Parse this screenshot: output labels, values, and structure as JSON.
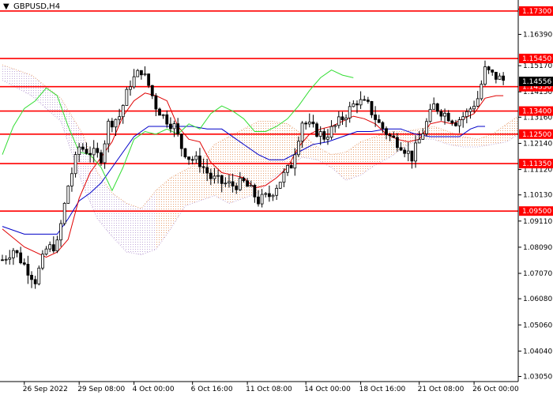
{
  "colors": {
    "background": "#ffffff",
    "level_line": "#ff0000",
    "candle": "#000000",
    "tenkan": "#e00000",
    "kijun": "#0000c8",
    "chikou": "#33dd33",
    "cloud_bull": "#e7a070",
    "cloud_bear": "#c0a8d8",
    "axis": "#000000",
    "price_tag": "#000000"
  },
  "chart_data": {
    "type": "line",
    "title": "GBPUSD,H4",
    "title_marker": "▼",
    "xlabel": "",
    "ylabel": "",
    "y_axis_position": "right",
    "ylim": [
      1.0285,
      1.177
    ],
    "xlim": [
      0,
      140
    ],
    "grid": false,
    "y_ticks": [
      "1.17370",
      "1.16390",
      "1.15170",
      "1.14150",
      "1.13160",
      "1.12140",
      "1.11120",
      "1.10130",
      "1.09110",
      "1.08090",
      "1.07070",
      "1.06080",
      "1.05060",
      "1.04040",
      "1.03050"
    ],
    "x_ticks": [
      {
        "label": "26 Sep 2022",
        "x": 6
      },
      {
        "label": "29 Sep 08:00",
        "x": 21
      },
      {
        "label": "4 Oct 00:00",
        "x": 36
      },
      {
        "label": "6 Oct 16:00",
        "x": 52
      },
      {
        "label": "11 Oct 08:00",
        "x": 67
      },
      {
        "label": "14 Oct 00:00",
        "x": 83
      },
      {
        "label": "18 Oct 16:00",
        "x": 98
      },
      {
        "label": "21 Oct 08:00",
        "x": 114
      },
      {
        "label": "26 Oct 00:00",
        "x": 129
      }
    ],
    "levels": [
      {
        "label": "1.17300",
        "value": 1.173
      },
      {
        "label": "1.15450",
        "value": 1.1545
      },
      {
        "label": "1.14350",
        "value": 1.1435
      },
      {
        "label": "1.13400",
        "value": 1.134
      },
      {
        "label": "1.12500",
        "value": 1.125
      },
      {
        "label": "1.11350",
        "value": 1.1135
      },
      {
        "label": "1.09500",
        "value": 1.095
      }
    ],
    "last_price": {
      "label": "1.14556",
      "value": 1.14556
    },
    "candles_anchors": [
      [
        0,
        1.076
      ],
      [
        3,
        1.08
      ],
      [
        6,
        1.074
      ],
      [
        9,
        1.068
      ],
      [
        12,
        1.08
      ],
      [
        15,
        1.082
      ],
      [
        18,
        1.105
      ],
      [
        21,
        1.12
      ],
      [
        24,
        1.118
      ],
      [
        27,
        1.116
      ],
      [
        29,
        1.129
      ],
      [
        32,
        1.132
      ],
      [
        35,
        1.145
      ],
      [
        38,
        1.15
      ],
      [
        40,
        1.144
      ],
      [
        42,
        1.136
      ],
      [
        44,
        1.132
      ],
      [
        47,
        1.128
      ],
      [
        49,
        1.12
      ],
      [
        51,
        1.116
      ],
      [
        54,
        1.114
      ],
      [
        57,
        1.108
      ],
      [
        60,
        1.106
      ],
      [
        63,
        1.105
      ],
      [
        66,
        1.106
      ],
      [
        68,
        1.103
      ],
      [
        70,
        1.099
      ],
      [
        73,
        1.101
      ],
      [
        76,
        1.107
      ],
      [
        79,
        1.113
      ],
      [
        82,
        1.13
      ],
      [
        85,
        1.127
      ],
      [
        88,
        1.124
      ],
      [
        91,
        1.128
      ],
      [
        94,
        1.133
      ],
      [
        97,
        1.138
      ],
      [
        100,
        1.136
      ],
      [
        103,
        1.129
      ],
      [
        106,
        1.124
      ],
      [
        109,
        1.121
      ],
      [
        112,
        1.116
      ],
      [
        115,
        1.126
      ],
      [
        118,
        1.136
      ],
      [
        121,
        1.133
      ],
      [
        124,
        1.13
      ],
      [
        127,
        1.133
      ],
      [
        130,
        1.139
      ],
      [
        132,
        1.15
      ],
      [
        134,
        1.148
      ],
      [
        137,
        1.146
      ]
    ],
    "tenkan": [
      [
        0,
        1.088
      ],
      [
        6,
        1.081
      ],
      [
        12,
        1.077
      ],
      [
        15,
        1.079
      ],
      [
        18,
        1.084
      ],
      [
        21,
        1.1
      ],
      [
        24,
        1.11
      ],
      [
        27,
        1.116
      ],
      [
        30,
        1.122
      ],
      [
        33,
        1.132
      ],
      [
        36,
        1.138
      ],
      [
        39,
        1.141
      ],
      [
        42,
        1.14
      ],
      [
        45,
        1.138
      ],
      [
        48,
        1.128
      ],
      [
        51,
        1.123
      ],
      [
        54,
        1.122
      ],
      [
        57,
        1.114
      ],
      [
        60,
        1.11
      ],
      [
        63,
        1.109
      ],
      [
        66,
        1.108
      ],
      [
        69,
        1.104
      ],
      [
        72,
        1.105
      ],
      [
        75,
        1.108
      ],
      [
        78,
        1.112
      ],
      [
        81,
        1.12
      ],
      [
        84,
        1.125
      ],
      [
        87,
        1.127
      ],
      [
        90,
        1.128
      ],
      [
        93,
        1.13
      ],
      [
        96,
        1.132
      ],
      [
        99,
        1.131
      ],
      [
        102,
        1.129
      ],
      [
        105,
        1.125
      ],
      [
        108,
        1.123
      ],
      [
        111,
        1.122
      ],
      [
        114,
        1.123
      ],
      [
        117,
        1.129
      ],
      [
        120,
        1.13
      ],
      [
        123,
        1.129
      ],
      [
        126,
        1.131
      ],
      [
        129,
        1.133
      ],
      [
        132,
        1.139
      ],
      [
        135,
        1.14
      ],
      [
        137,
        1.14
      ]
    ],
    "kijun": [
      [
        0,
        1.089
      ],
      [
        6,
        1.086
      ],
      [
        12,
        1.086
      ],
      [
        15,
        1.086
      ],
      [
        18,
        1.092
      ],
      [
        21,
        1.099
      ],
      [
        24,
        1.102
      ],
      [
        27,
        1.106
      ],
      [
        30,
        1.112
      ],
      [
        33,
        1.118
      ],
      [
        36,
        1.124
      ],
      [
        40,
        1.128
      ],
      [
        44,
        1.128
      ],
      [
        48,
        1.128
      ],
      [
        52,
        1.128
      ],
      [
        56,
        1.127
      ],
      [
        60,
        1.127
      ],
      [
        64,
        1.123
      ],
      [
        67,
        1.12
      ],
      [
        70,
        1.117
      ],
      [
        73,
        1.115
      ],
      [
        77,
        1.115
      ],
      [
        81,
        1.118
      ],
      [
        85,
        1.121
      ],
      [
        89,
        1.122
      ],
      [
        93,
        1.124
      ],
      [
        97,
        1.126
      ],
      [
        101,
        1.126
      ],
      [
        105,
        1.127
      ],
      [
        109,
        1.127
      ],
      [
        113,
        1.125
      ],
      [
        117,
        1.124
      ],
      [
        121,
        1.124
      ],
      [
        125,
        1.124
      ],
      [
        128,
        1.127
      ],
      [
        130,
        1.128
      ],
      [
        132,
        1.128
      ]
    ],
    "chikou": [
      [
        0,
        1.117
      ],
      [
        3,
        1.128
      ],
      [
        6,
        1.135
      ],
      [
        9,
        1.138
      ],
      [
        12,
        1.143
      ],
      [
        15,
        1.14
      ],
      [
        18,
        1.128
      ],
      [
        21,
        1.118
      ],
      [
        24,
        1.117
      ],
      [
        27,
        1.112
      ],
      [
        30,
        1.103
      ],
      [
        33,
        1.112
      ],
      [
        36,
        1.123
      ],
      [
        39,
        1.126
      ],
      [
        42,
        1.125
      ],
      [
        45,
        1.127
      ],
      [
        48,
        1.125
      ],
      [
        51,
        1.129
      ],
      [
        54,
        1.127
      ],
      [
        57,
        1.133
      ],
      [
        60,
        1.136
      ],
      [
        63,
        1.134
      ],
      [
        66,
        1.131
      ],
      [
        69,
        1.126
      ],
      [
        72,
        1.126
      ],
      [
        75,
        1.128
      ],
      [
        78,
        1.131
      ],
      [
        81,
        1.136
      ],
      [
        84,
        1.142
      ],
      [
        87,
        1.147
      ],
      [
        90,
        1.15
      ],
      [
        93,
        1.148
      ],
      [
        96,
        1.147
      ]
    ],
    "cloud": [
      [
        0,
        1.152,
        1.146
      ],
      [
        8,
        1.148,
        1.14
      ],
      [
        16,
        1.139,
        1.13
      ],
      [
        22,
        1.125,
        1.105
      ],
      [
        26,
        1.11,
        1.092
      ],
      [
        30,
        1.102,
        1.085
      ],
      [
        34,
        1.098,
        1.079
      ],
      [
        38,
        1.096,
        1.078
      ],
      [
        42,
        1.103,
        1.08
      ],
      [
        46,
        1.108,
        1.088
      ],
      [
        50,
        1.111,
        1.097
      ],
      [
        54,
        1.114,
        1.099
      ],
      [
        58,
        1.121,
        1.101
      ],
      [
        62,
        1.124,
        1.098
      ],
      [
        66,
        1.127,
        1.1
      ],
      [
        70,
        1.13,
        1.102
      ],
      [
        74,
        1.13,
        1.108
      ],
      [
        78,
        1.129,
        1.112
      ],
      [
        82,
        1.125,
        1.116
      ],
      [
        86,
        1.12,
        1.115
      ],
      [
        90,
        1.117,
        1.112
      ],
      [
        94,
        1.118,
        1.107
      ],
      [
        98,
        1.122,
        1.109
      ],
      [
        102,
        1.124,
        1.113
      ],
      [
        106,
        1.126,
        1.116
      ],
      [
        110,
        1.126,
        1.12
      ],
      [
        114,
        1.127,
        1.123
      ],
      [
        118,
        1.128,
        1.123
      ],
      [
        122,
        1.126,
        1.121
      ],
      [
        126,
        1.124,
        1.12
      ],
      [
        130,
        1.123,
        1.12
      ],
      [
        134,
        1.125,
        1.121
      ],
      [
        138,
        1.129,
        1.122
      ],
      [
        142,
        1.132,
        1.125
      ],
      [
        146,
        1.131,
        1.127
      ]
    ]
  }
}
